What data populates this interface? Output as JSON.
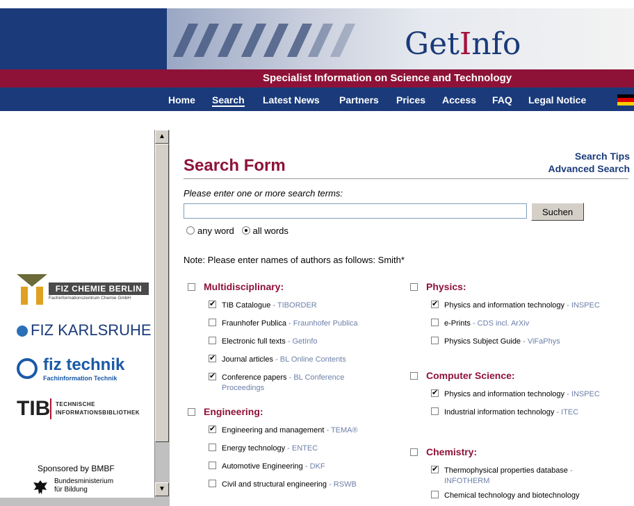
{
  "brand": {
    "logo_pre": "Get",
    "logo_i": "I",
    "logo_post": "nfo",
    "tagline": "Specialist Information on Science and Technology"
  },
  "nav": [
    "Home",
    "Search",
    "Latest News",
    "Partners",
    "Prices",
    "Access",
    "FAQ",
    "Legal Notice"
  ],
  "sidebar": {
    "fiz_chemie": "FIZ CHEMIE BERLIN",
    "fiz_chemie_sub": "Fachinformationszentrum Chemie GmbH",
    "fiz_karlsruhe": "FIZ KARLSRUHE",
    "fiz_technik": "fiz technik",
    "fiz_technik_sub": "Fachinformation Technik",
    "tib": "TIB",
    "tib_line1": "TECHNISCHE",
    "tib_line2": "INFORMATIONSBIBLIOTHEK",
    "sponsored": "Sponsored by BMBF",
    "bmbf": "Bundesministerium für Bildung"
  },
  "main": {
    "search_tips": "Search Tips",
    "advanced_search": "Advanced Search",
    "title": "Search Form",
    "instruction": "Please enter one or more search terms:",
    "search_value": "",
    "search_button": "Suchen",
    "any_word": "any word",
    "all_words": "all words",
    "note": "Note: Please enter names of authors as follows: Smith*"
  },
  "left_categories": [
    {
      "name": "Multidisciplinary:",
      "databases": [
        {
          "label": "TIB Catalogue",
          "source": "TIBORDER",
          "checked": true
        },
        {
          "label": "Fraunhofer Publica",
          "source": "Fraunhofer Publica",
          "checked": false
        },
        {
          "label": "Electronic full texts",
          "source": "GetInfo",
          "checked": false
        },
        {
          "label": "Journal articles",
          "source": "BL Online Contents",
          "checked": true
        },
        {
          "label": "Conference papers",
          "source": "BL Conference Proceedings",
          "checked": true
        }
      ]
    },
    {
      "name": "Engineering:",
      "databases": [
        {
          "label": "Engineering and management",
          "source": "TEMA®",
          "checked": true
        },
        {
          "label": "Energy technology",
          "source": "ENTEC",
          "checked": false
        },
        {
          "label": "Automotive Engineering",
          "source": "DKF",
          "checked": false
        },
        {
          "label": "Civil and structural engineering",
          "source": "RSWB",
          "checked": false
        }
      ]
    }
  ],
  "right_categories": [
    {
      "name": "Physics:",
      "databases": [
        {
          "label": "Physics and information technology",
          "source": "INSPEC",
          "checked": true
        },
        {
          "label": "e-Prints",
          "source": "CDS incl. ArXiv",
          "checked": false
        },
        {
          "label": "Physics Subject Guide",
          "source": "ViFaPhys",
          "checked": false
        }
      ]
    },
    {
      "name": "Computer Science:",
      "databases": [
        {
          "label": "Physics and information technology",
          "source": "INSPEC",
          "checked": true
        },
        {
          "label": "Industrial information technology",
          "source": "ITEC",
          "checked": false
        }
      ]
    },
    {
      "name": "Chemistry:",
      "databases": [
        {
          "label": "Thermophysical properties database",
          "source": "INFOTHERM",
          "checked": true
        },
        {
          "label": "Chemical technology and biotechnology",
          "source": "",
          "checked": false
        }
      ]
    }
  ],
  "colors": {
    "brand_blue": "#1a3a7a",
    "brand_maroon": "#8e1238",
    "source_link": "#6c7fa8"
  }
}
